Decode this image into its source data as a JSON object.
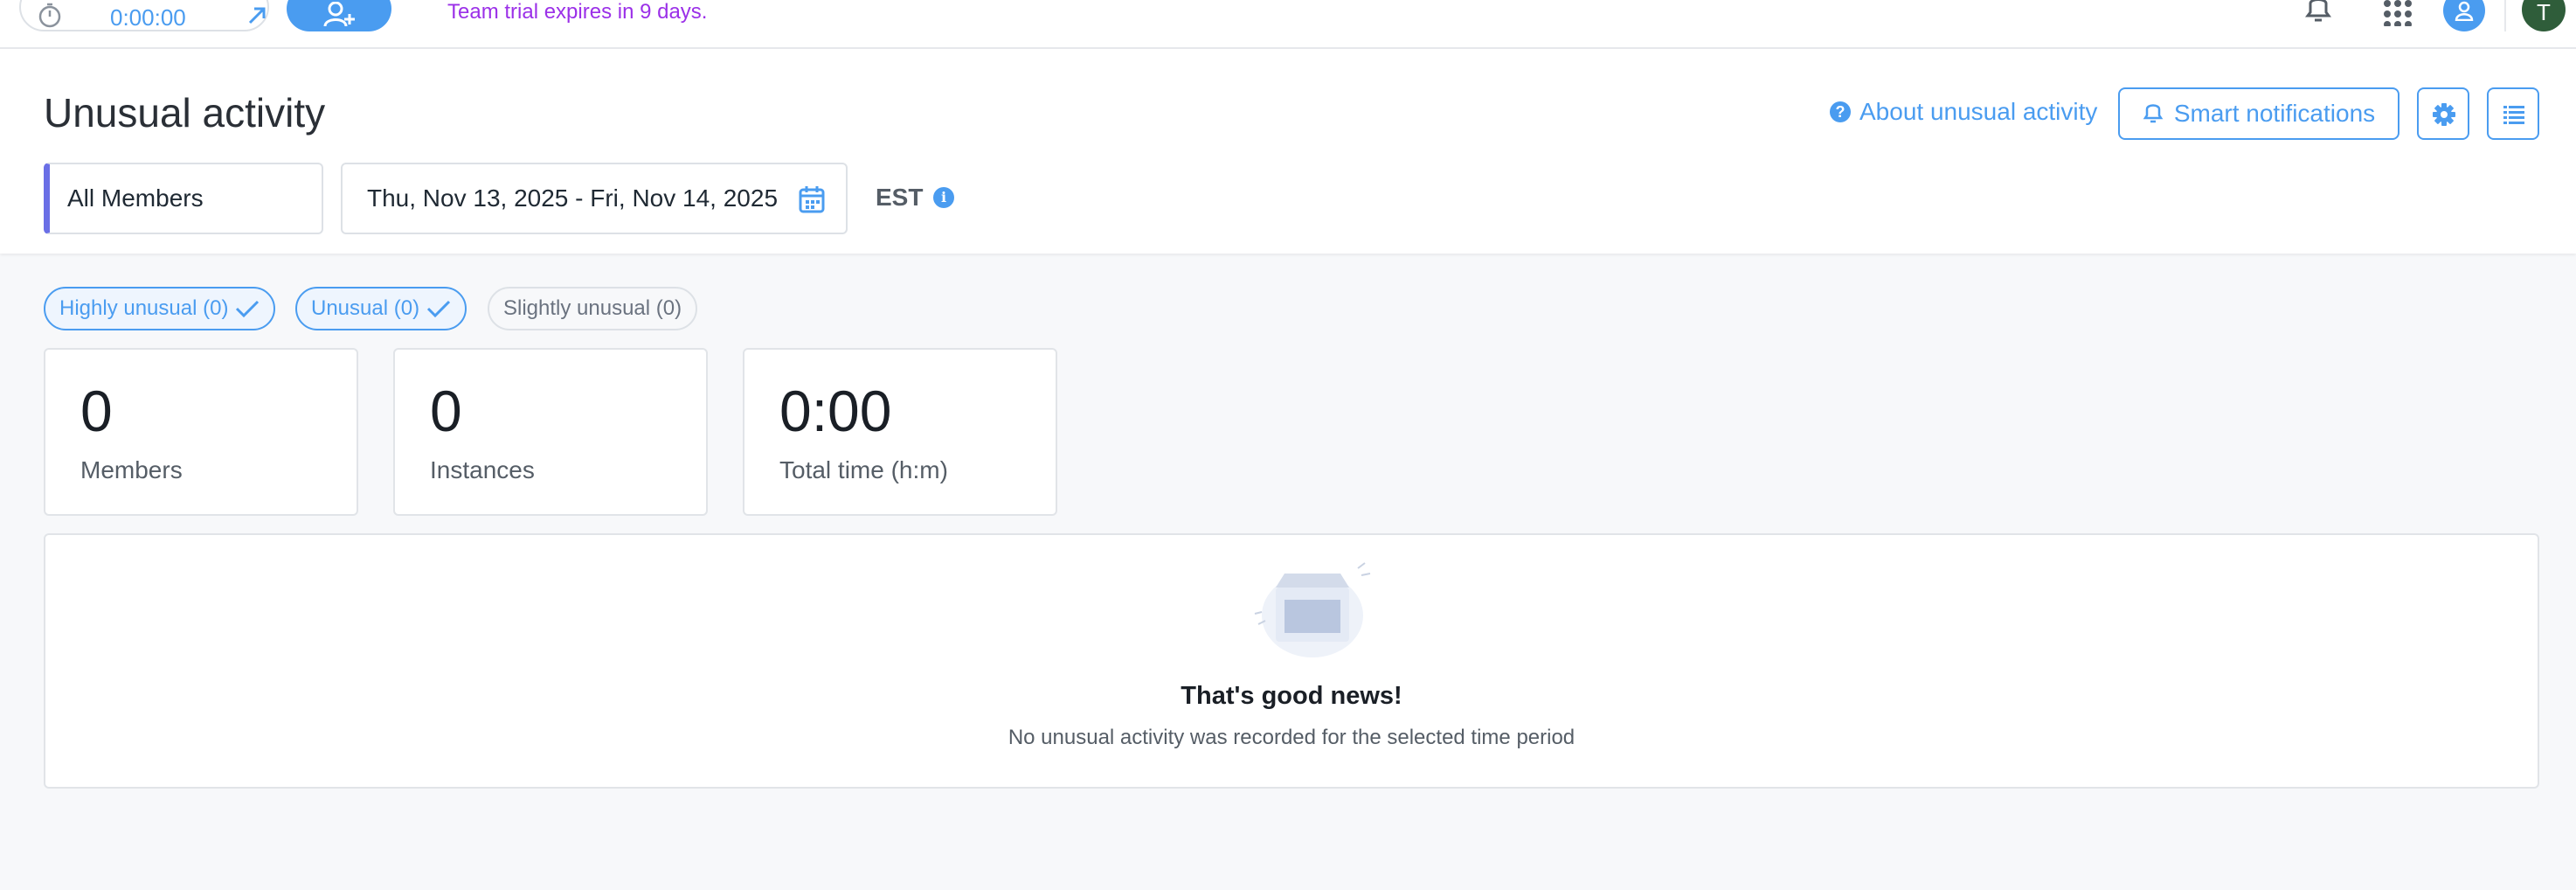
{
  "topbar": {
    "timer_value": "0:00:00",
    "trial_notice": "Team trial expires in 9 days.",
    "avatar_initial": "T"
  },
  "header": {
    "title": "Unusual activity",
    "about_link": "About unusual activity",
    "smart_notifications": "Smart notifications",
    "members_filter": "All Members",
    "date_range": "Thu, Nov 13, 2025 - Fri, Nov 14, 2025",
    "timezone": "EST"
  },
  "filters": [
    {
      "label": "Highly unusual (0)",
      "selected": true
    },
    {
      "label": "Unusual (0)",
      "selected": true
    },
    {
      "label": "Slightly unusual (0)",
      "selected": false
    }
  ],
  "stats": [
    {
      "value": "0",
      "label": "Members"
    },
    {
      "value": "0",
      "label": "Instances"
    },
    {
      "value": "0:00",
      "label": "Total time (h:m)"
    }
  ],
  "empty_state": {
    "heading": "That's good news!",
    "message": "No unusual activity was recorded for the selected time period"
  },
  "colors": {
    "accent": "#4a9cf0",
    "trial_text": "#9b30e8",
    "member_select_bar": "#6a6fe6",
    "avatar_bg": "#2f5d3a"
  }
}
